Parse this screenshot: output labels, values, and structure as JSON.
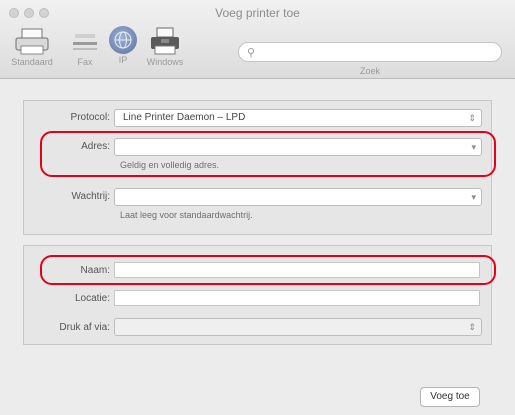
{
  "window": {
    "title": "Voeg printer toe"
  },
  "toolbar": {
    "items": [
      {
        "label": "Standaard",
        "icon": "printer-icon"
      },
      {
        "label": "Fax",
        "icon": "fax-icon"
      },
      {
        "label": "IP",
        "icon": "globe-icon"
      },
      {
        "label": "Windows",
        "icon": "windows-printer-icon"
      }
    ],
    "search_placeholder": "",
    "search_label": "Zoek"
  },
  "form": {
    "protocol_label": "Protocol:",
    "protocol_value": "Line Printer Daemon – LPD",
    "address_label": "Adres:",
    "address_value": "",
    "address_hint": "Geldig en volledig adres.",
    "queue_label": "Wachtrij:",
    "queue_value": "",
    "queue_hint": "Laat leeg voor standaardwachtrij.",
    "name_label": "Naam:",
    "name_value": "",
    "location_label": "Locatie:",
    "location_value": "",
    "print_using_label": "Druk af via:",
    "print_using_value": ""
  },
  "buttons": {
    "add_label": "Voeg toe"
  },
  "colors": {
    "highlight": "#e2001a"
  }
}
